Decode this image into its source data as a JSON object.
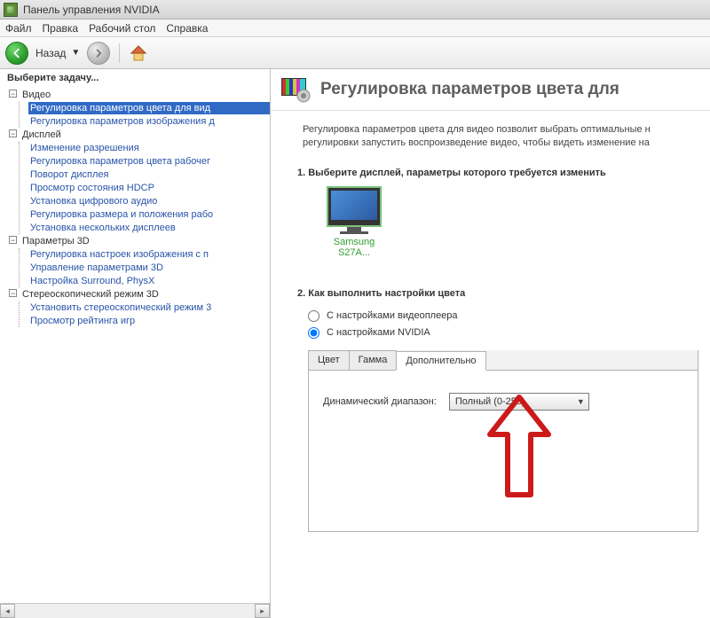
{
  "window": {
    "title": "Панель управления NVIDIA"
  },
  "menu": {
    "file": "Файл",
    "edit": "Правка",
    "desktop": "Рабочий стол",
    "help": "Справка"
  },
  "toolbar": {
    "back": "Назад"
  },
  "sidebar": {
    "header": "Выберите задачу...",
    "groups": [
      {
        "label": "Видео",
        "items": [
          "Регулировка параметров цвета для вид",
          "Регулировка параметров изображения д"
        ]
      },
      {
        "label": "Дисплей",
        "items": [
          "Изменение разрешения",
          "Регулировка параметров цвета рабочег",
          "Поворот дисплея",
          "Просмотр состояния HDCP",
          "Установка цифрового аудио",
          "Регулировка размера и положения рабо",
          "Установка нескольких дисплеев"
        ]
      },
      {
        "label": "Параметры 3D",
        "items": [
          "Регулировка настроек изображения с п",
          "Управление параметрами 3D",
          "Настройка Surround, PhysX"
        ]
      },
      {
        "label": "Стереоскопический режим 3D",
        "items": [
          "Установить стереоскопический режим 3",
          "Просмотр рейтинга игр"
        ]
      }
    ]
  },
  "content": {
    "title": "Регулировка параметров цвета для",
    "desc": "Регулировка параметров цвета для видео позволит выбрать оптимальные н регулировки запустить воспроизведение видео, чтобы видеть изменение на",
    "step1": "1. Выберите дисплей, параметры которого требуется изменить",
    "display_name": "Samsung S27A...",
    "step2": "2. Как выполнить настройки цвета",
    "opt_player": "С настройками видеоплеера",
    "opt_nvidia": "С настройками NVIDIA",
    "tabs": {
      "color": "Цвет",
      "gamma": "Гамма",
      "advanced": "Дополнительно"
    },
    "range_label": "Динамический диапазон:",
    "range_value": "Полный (0-255)"
  }
}
